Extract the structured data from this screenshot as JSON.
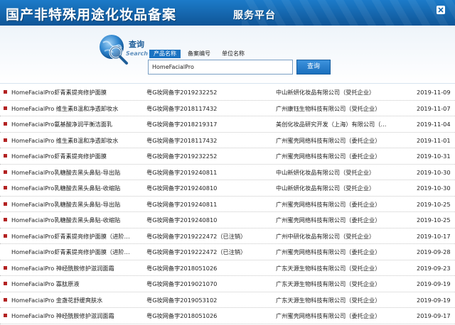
{
  "header": {
    "title": "国产非特殊用途化妆品备案",
    "subtitle": "服务平台"
  },
  "search": {
    "logo_cn": "查询",
    "logo_en": "Search",
    "tabs": [
      "产品名称",
      "备案编号",
      "单位名称"
    ],
    "active_tab": 0,
    "query": "HomeFacialPro",
    "button_label": "查询"
  },
  "results": [
    {
      "name": "HomeFacialPro虾青素提亮修护面膜",
      "code": "粤G妆网备字2019232252",
      "company": "中山新妍化妆品有限公司（受托企业）",
      "date": "2019-11-09",
      "bullet": true
    },
    {
      "name": "HomeFacialPro 维生素B温和净透卸妆水",
      "code": "粤G妆网备字2018117432",
      "company": "广州康钰生物科技有限公司（受托企业）",
      "date": "2019-11-07",
      "bullet": true
    },
    {
      "name": "HomeFacialPro氨基酸净润平衡洁面乳",
      "code": "粤G妆网备字2018219317",
      "company": "美创化妆品研究开发（上海）有限公司（…",
      "date": "2019-11-04",
      "bullet": true
    },
    {
      "name": "HomeFacialPro 维生素B温和净透卸妆水",
      "code": "粤G妆网备字2018117432",
      "company": "广州蜜壳网络科技有限公司（委托企业）",
      "date": "2019-11-01",
      "bullet": true
    },
    {
      "name": "HomeFacialPro虾青素提亮修护面膜",
      "code": "粤G妆网备字2019232252",
      "company": "广州蜜壳网络科技有限公司（委托企业）",
      "date": "2019-10-31",
      "bullet": true
    },
    {
      "name": "HomeFacialPro乳糖酸去黑头鼻贴-导出贴",
      "code": "粤G妆网备字2019240811",
      "company": "中山新妍化妆品有限公司（受托企业）",
      "date": "2019-10-30",
      "bullet": true
    },
    {
      "name": "HomeFacialPro乳糖酸去黑头鼻贴-收缩贴",
      "code": "粤G妆网备字2019240810",
      "company": "中山新妍化妆品有限公司（受托企业）",
      "date": "2019-10-30",
      "bullet": true
    },
    {
      "name": "HomeFacialPro乳糖酸去黑头鼻贴-导出贴",
      "code": "粤G妆网备字2019240811",
      "company": "广州蜜壳网络科技有限公司（委托企业）",
      "date": "2019-10-25",
      "bullet": true
    },
    {
      "name": "HomeFacialPro乳糖酸去黑头鼻贴-收缩贴",
      "code": "粤G妆网备字2019240810",
      "company": "广州蜜壳网络科技有限公司（委托企业）",
      "date": "2019-10-25",
      "bullet": true
    },
    {
      "name": "HomeFacialPro虾青素提亮修护面膜（进阶…",
      "code": "粤G妆网备字2019222472（已注销）",
      "company": "广州中研化妆品有限公司（受托企业）",
      "date": "2019-10-17",
      "bullet": true
    },
    {
      "name": "HomeFacialPro虾青素提亮修护面膜（进阶…",
      "code": "粤G妆网备字2019222472（已注销）",
      "company": "广州蜜壳网络科技有限公司（委托企业）",
      "date": "2019-09-28",
      "bullet": false
    },
    {
      "name": "HomeFacialPro 神经酰胺修护滋润面霜",
      "code": "粤G妆网备字2018051026",
      "company": "广东天源生物科技有限公司（受托企业）",
      "date": "2019-09-23",
      "bullet": true
    },
    {
      "name": "HomeFacialPro 寡肽原液",
      "code": "粤G妆网备字2019021070",
      "company": "广东天源生物科技有限公司（受托企业）",
      "date": "2019-09-19",
      "bullet": true
    },
    {
      "name": "HomeFacialPro 金盏花舒缓爽肤水",
      "code": "粤G妆网备字2019053102",
      "company": "广东天源生物科技有限公司（受托企业）",
      "date": "2019-09-19",
      "bullet": true
    },
    {
      "name": "HomeFacialPro 神经酰胺修护滋润面霜",
      "code": "粤G妆网备字2018051026",
      "company": "广州蜜壳网络科技有限公司（委托企业）",
      "date": "2019-09-17",
      "bullet": true
    }
  ]
}
